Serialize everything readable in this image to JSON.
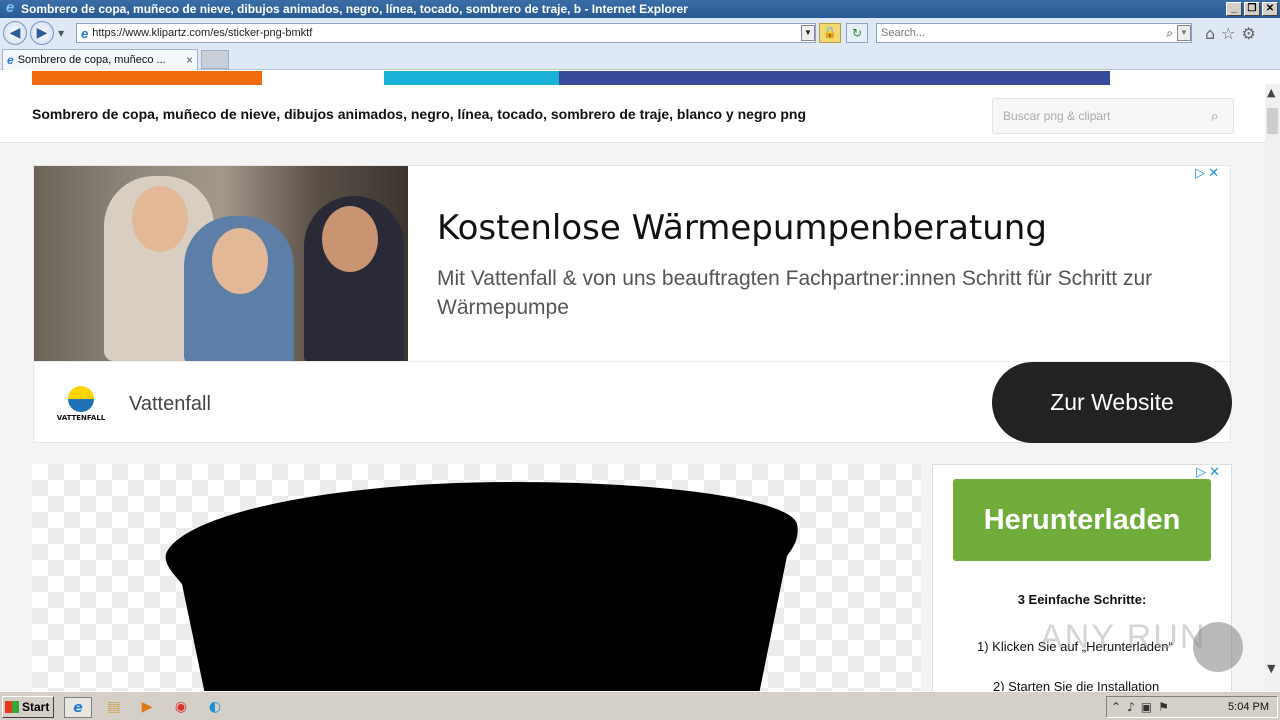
{
  "window": {
    "title": "Sombrero de copa, muñeco de nieve, dibujos animados, negro, línea, tocado, sombrero de traje, b - Internet Explorer"
  },
  "browser": {
    "url": "https://www.klipartz.com/es/sticker-png-bmktf",
    "search_placeholder": "Search...",
    "tab_title": "Sombrero de copa, muñeco ...",
    "tab_close": "×"
  },
  "site": {
    "page_title": "Sombrero de copa, muñeco de nieve, dibujos animados, negro, línea, tocado, sombrero de traje, blanco y negro png",
    "search_placeholder": "Buscar png & clipart"
  },
  "ad1": {
    "headline": "Kostenlose Wärmepumpenberatung",
    "description": "Mit Vattenfall & von uns beauftragten Fachpartner:innen Schritt für Schritt zur Wärmepumpe",
    "advertiser": "Vattenfall",
    "logo_text": "VATTENFALL",
    "cta": "Zur Website"
  },
  "ad2": {
    "button": "Herunterladen",
    "heading": "3 Eeinfache Schritte:",
    "step1": "1) Klicken Sie auf „Herunterladen“",
    "step2": "2) Starten Sie die Installation"
  },
  "watermark": "ANY RUN",
  "taskbar": {
    "start": "Start",
    "clock": "5:04 PM"
  }
}
